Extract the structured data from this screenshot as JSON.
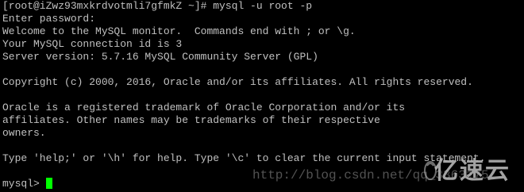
{
  "terminal": {
    "lines": [
      "[root@iZwz93mxkrdvotmli7gfmkZ ~]# mysql -u root -p",
      "Enter password:",
      "Welcome to the MySQL monitor.  Commands end with ; or \\g.",
      "Your MySQL connection id is 3",
      "Server version: 5.7.16 MySQL Community Server (GPL)",
      "",
      "Copyright (c) 2000, 2016, Oracle and/or its affiliates. All rights reserved.",
      "",
      "Oracle is a registered trademark of Oracle Corporation and/or its",
      "affiliates. Other names may be trademarks of their respective",
      "owners.",
      "",
      "Type 'help;' or '\\h' for help. Type '\\c' to clear the current input statement.",
      "",
      "mysql> "
    ],
    "cursor_color": "#00ff00",
    "text_color": "#c0c0c0",
    "background_color": "#000000"
  },
  "watermark": {
    "url_text": "http://blog.csdn.net/qq_3363175",
    "logo_text": "亿速云"
  }
}
